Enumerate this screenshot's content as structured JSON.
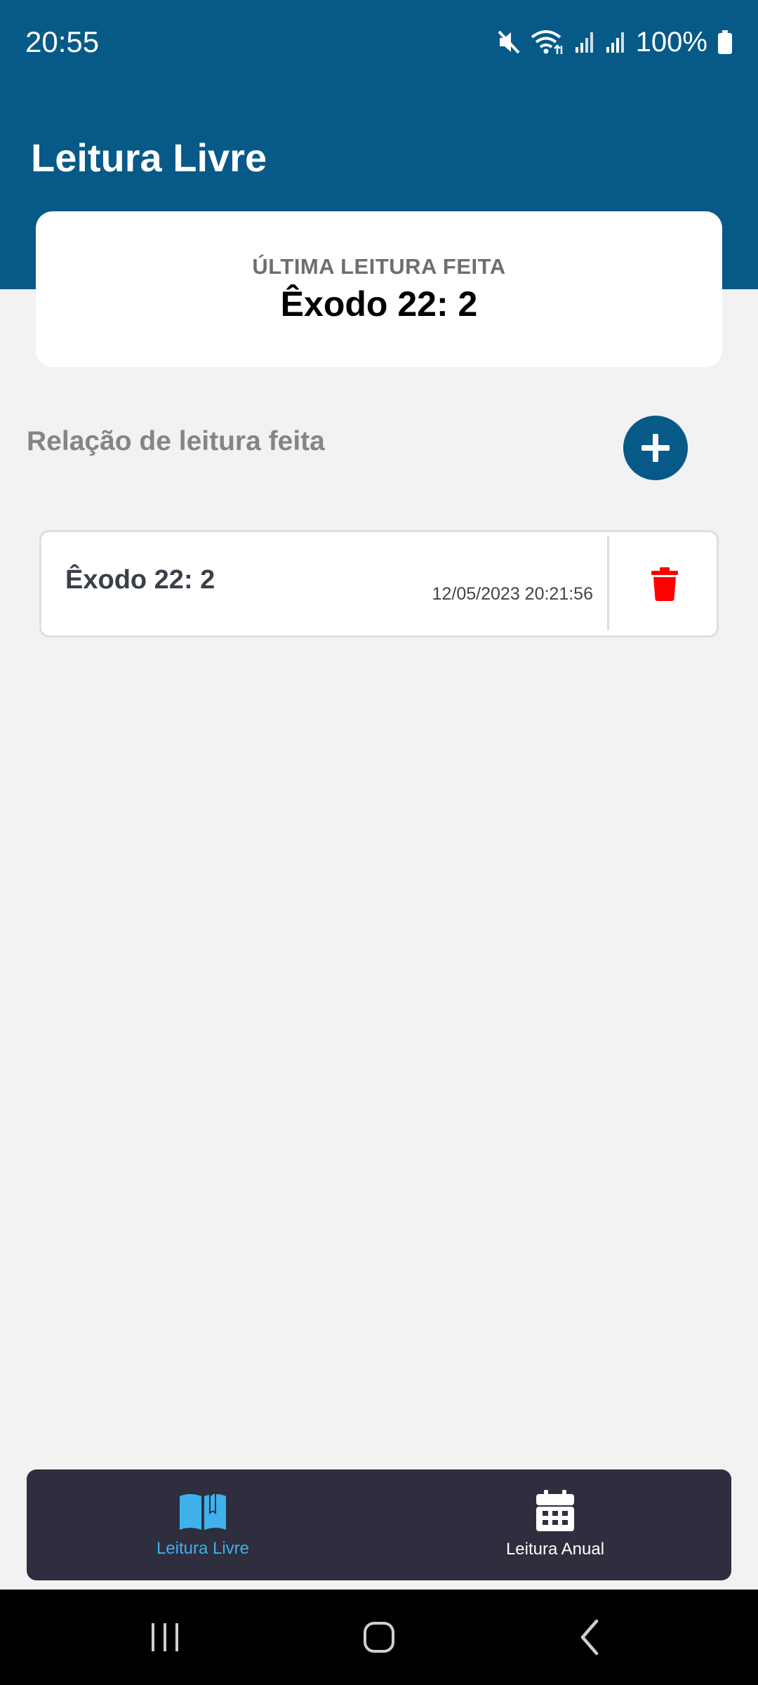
{
  "status_bar": {
    "time": "20:55",
    "battery_text": "100%",
    "icons": [
      "mute-icon",
      "wifi-icon",
      "signal-icon",
      "signal-icon",
      "battery-icon"
    ]
  },
  "header": {
    "title": "Leitura Livre",
    "background_color": "#075a87"
  },
  "last_reading": {
    "label": "ÚLTIMA LEITURA FEITA",
    "value": "Êxodo 22: 2"
  },
  "readings_section": {
    "title": "Relação de leitura feita",
    "add_icon": "plus-icon",
    "items": [
      {
        "title": "Êxodo 22: 2",
        "date": "12/05/2023 20:21:56",
        "delete_icon": "trash-icon",
        "delete_color": "#ff0000"
      }
    ]
  },
  "bottom_nav": {
    "tabs": [
      {
        "label": "Leitura Livre",
        "icon": "book-icon",
        "active": true,
        "color": "#3fb2ec"
      },
      {
        "label": "Leitura Anual",
        "icon": "calendar-icon",
        "active": false,
        "color": "#ffffff"
      }
    ]
  },
  "system_nav": {
    "buttons": [
      "recent-apps-icon",
      "home-icon",
      "back-icon"
    ]
  }
}
